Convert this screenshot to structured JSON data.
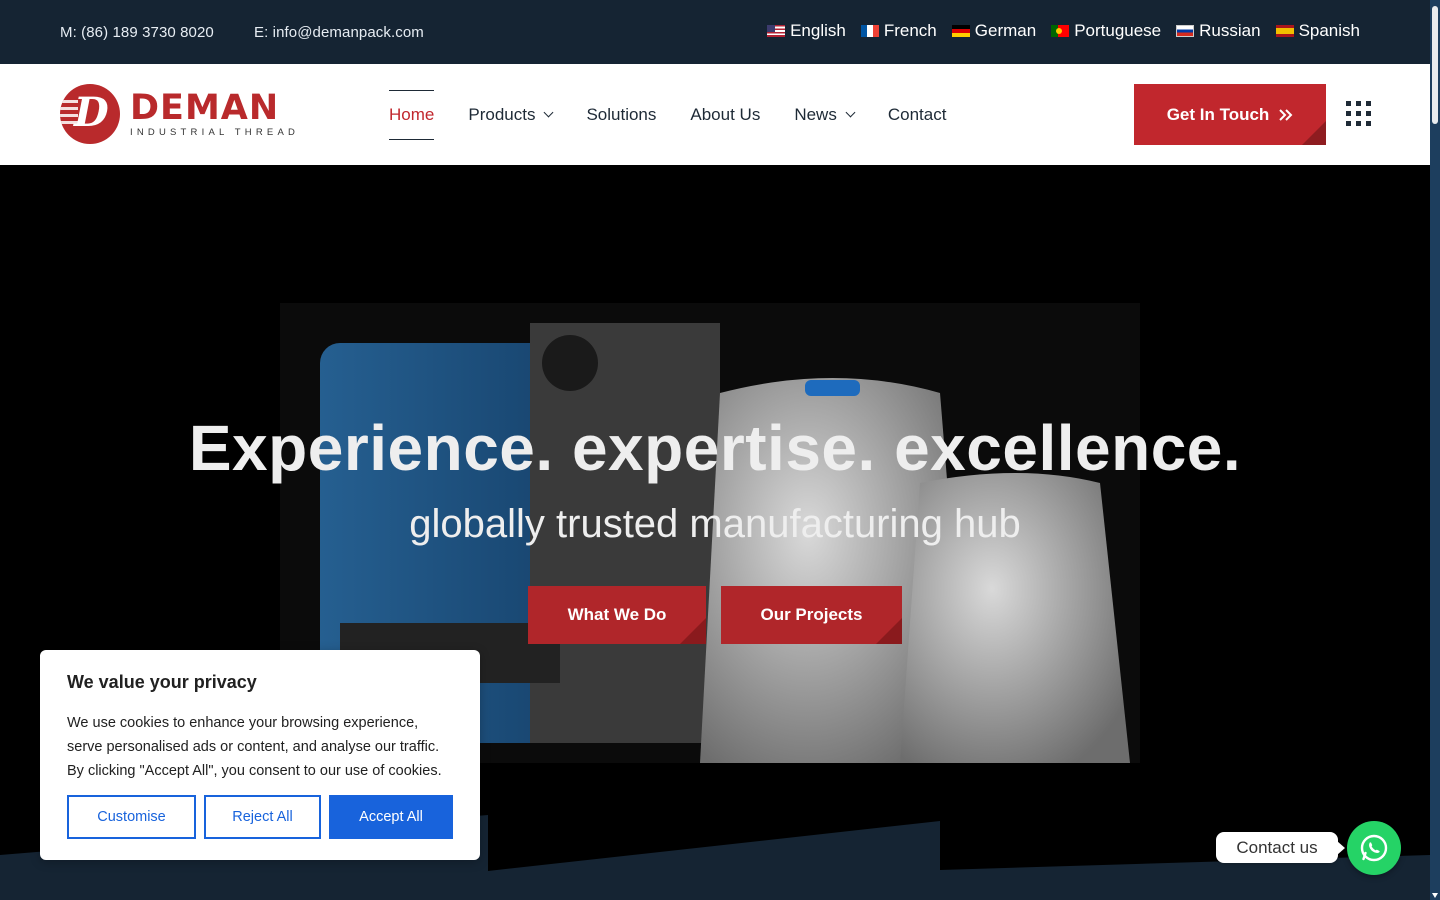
{
  "topbar": {
    "phone": "M: (86) 189 3730 8020",
    "email": "E: info@demanpack.com",
    "languages": [
      {
        "label": "English",
        "flag": "flag-us"
      },
      {
        "label": "French",
        "flag": "flag-fr"
      },
      {
        "label": "German",
        "flag": "flag-de"
      },
      {
        "label": "Portuguese",
        "flag": "flag-pt"
      },
      {
        "label": "Russian",
        "flag": "flag-ru"
      },
      {
        "label": "Spanish",
        "flag": "flag-es"
      }
    ]
  },
  "header": {
    "logo": {
      "name": "DEMAN",
      "tagline": "INDUSTRIAL THREAD"
    },
    "nav": [
      {
        "label": "Home",
        "active": true
      },
      {
        "label": "Products",
        "dropdown": true
      },
      {
        "label": "Solutions"
      },
      {
        "label": "About Us"
      },
      {
        "label": "News",
        "dropdown": true
      },
      {
        "label": "Contact"
      }
    ],
    "cta_label": "Get In Touch",
    "menu_icon": "grid-menu-icon"
  },
  "hero": {
    "title": "Experience. expertise. excellence.",
    "subtitle": "globally trusted manufacturing hub",
    "buttons": [
      "What We Do",
      "Our Projects"
    ]
  },
  "cookie": {
    "title": "We value your privacy",
    "text": "We use cookies to enhance your browsing experience, serve personalised ads or content, and analyse our traffic. By clicking \"Accept All\", you consent to our use of cookies.",
    "customise": "Customise",
    "reject": "Reject All",
    "accept": "Accept All"
  },
  "widget": {
    "label": "Contact us",
    "icon": "whatsapp-icon"
  },
  "colors": {
    "brand_red": "#c1272d",
    "topbar_bg": "#152433",
    "cookie_blue": "#1863dc",
    "whatsapp_green": "#25d366"
  }
}
